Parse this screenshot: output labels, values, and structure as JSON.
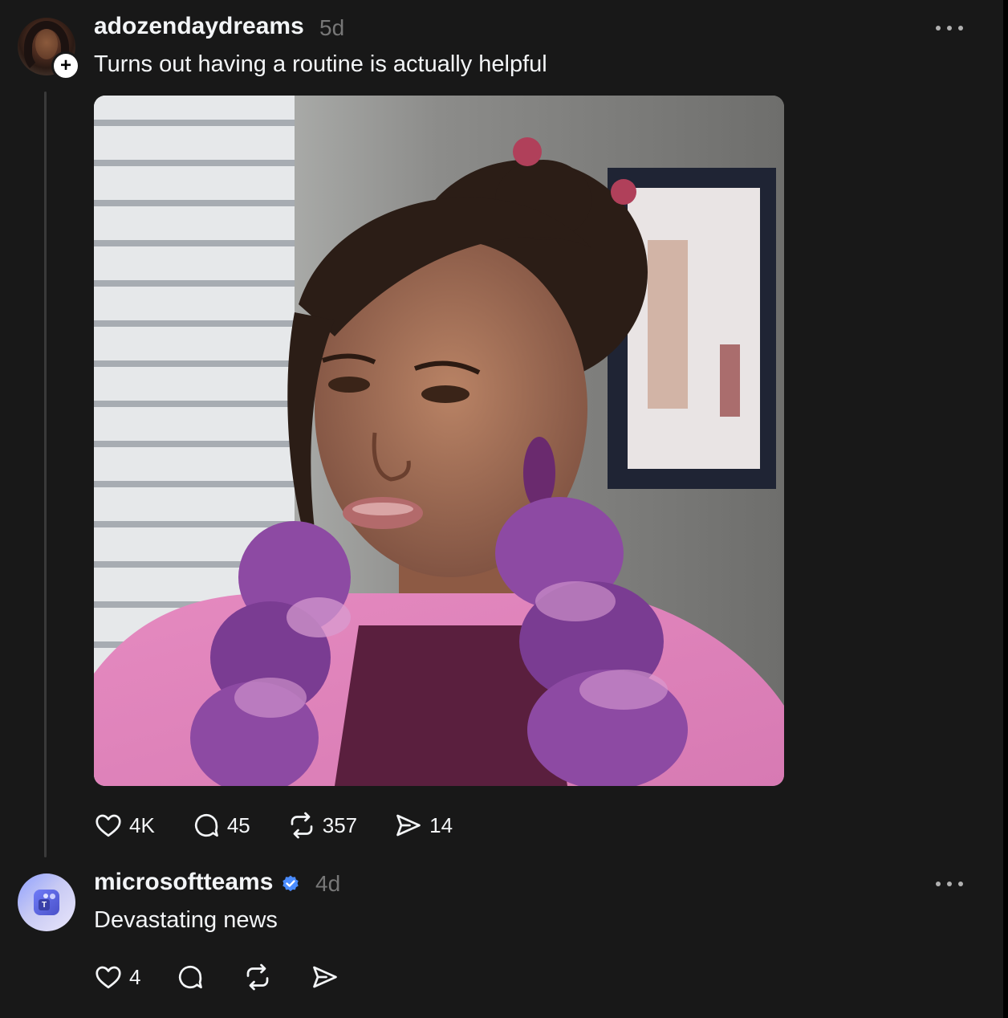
{
  "posts": [
    {
      "username": "adozendaydreams",
      "time": "5d",
      "text": "Turns out having a routine is actually helpful",
      "follow_symbol": "+",
      "likes": "4K",
      "comments": "45",
      "reposts": "357",
      "shares": "14"
    },
    {
      "username": "microsoftteams",
      "time": "4d",
      "text": "Devastating news",
      "verified_color": "#4a8cff",
      "likes": "4",
      "teams_letter": "T"
    }
  ],
  "colors": {
    "background": "#181818",
    "text": "#f3f5f7",
    "muted": "#777777",
    "thread_line": "#3a3a3a"
  }
}
